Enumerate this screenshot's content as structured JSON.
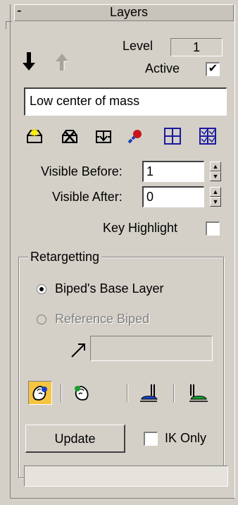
{
  "rollout": {
    "collapse_symbol": "-",
    "title": "Layers"
  },
  "level": {
    "label": "Level",
    "value": "1"
  },
  "active": {
    "label": "Active",
    "checked_glyph": "✔"
  },
  "layer_name": {
    "value": "Low center of mass"
  },
  "layer_tools": [
    "create-layer-icon",
    "delete-layer-icon",
    "collapse-layer-icon",
    "select-biped-icon",
    "visible-before-icon",
    "visible-after-icon"
  ],
  "visible_before": {
    "label": "Visible Before:",
    "value": "1"
  },
  "visible_after": {
    "label": "Visible After:",
    "value": "0"
  },
  "key_highlight": {
    "label": "Key Highlight"
  },
  "retargetting": {
    "title": "Retargetting",
    "base_layer_label": "Biped's Base Layer",
    "reference_biped_label": "Reference Biped",
    "retarget_icons": [
      "left-hand-icon",
      "right-hand-icon",
      "left-foot-icon",
      "right-foot-icon"
    ],
    "update_label": "Update",
    "ik_only_label": "IK Only"
  },
  "colors": {
    "panel": "#d4d0c8",
    "highlight": "#f5c542"
  }
}
